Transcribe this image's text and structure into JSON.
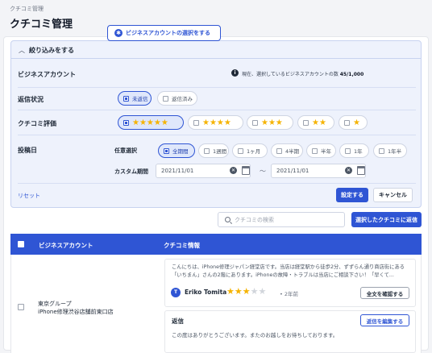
{
  "breadcrumb": "クチコミ管理",
  "page_title": "クチコミ管理",
  "filter": {
    "title": "絞り込みをする",
    "business_account_label": "ビジネスアカウント",
    "business_account_button": "ビジネスアカウントの選択をする",
    "info_prefix": "現在、選択しているビジネスアカウントの数",
    "info_count": "45/1,000",
    "reply_status_label": "返信状況",
    "reply_status_options": [
      "未返信",
      "返信済み"
    ],
    "rating_label": "クチコミ評価",
    "rating_options": [
      "★★★★★",
      "★★★★",
      "★★★",
      "★★",
      "★"
    ],
    "posted_date_label": "投稿日",
    "any_selection_label": "任意選択",
    "period_options": [
      "全期間",
      "1週間",
      "1ヶ月",
      "4半期",
      "半年",
      "1年",
      "1年半"
    ],
    "custom_period_label": "カスタム期間",
    "date_from": "2021/11/01",
    "date_to": "2021/11/01",
    "tilde": "〜",
    "reset": "リセット",
    "apply": "設定する",
    "cancel": "キャンセル"
  },
  "search": {
    "placeholder": "クチコミの検索"
  },
  "reply_selected_button": "選択したクチコミに返信",
  "table": {
    "headers": [
      "ビジネスアカウント",
      "クチコミ情報"
    ],
    "rows": [
      {
        "group": "東京グループ",
        "store": "iPhone修理渋谷店舗前東口店",
        "review_text": "こんにちは、iPhone修理ジャパン経堂店です。当店は経堂駅から徒歩2分、ずずらん通り商店街にある「いちまん」さんの2階にあります。iPhoneの故障・トラブルは当店にご相談下さい！「早くて...",
        "avatar_initial": "T",
        "reviewer": "Eriko Tomita",
        "stars_on": "★★★",
        "stars_off": "★★",
        "rating": 3,
        "date": "2年前",
        "view_full_button": "全文を確認する",
        "reply_label": "返信",
        "edit_reply_button": "返信を編集する",
        "reply_text": "この度はありがとうございます。またのお越しをお待ちしております。"
      }
    ]
  }
}
